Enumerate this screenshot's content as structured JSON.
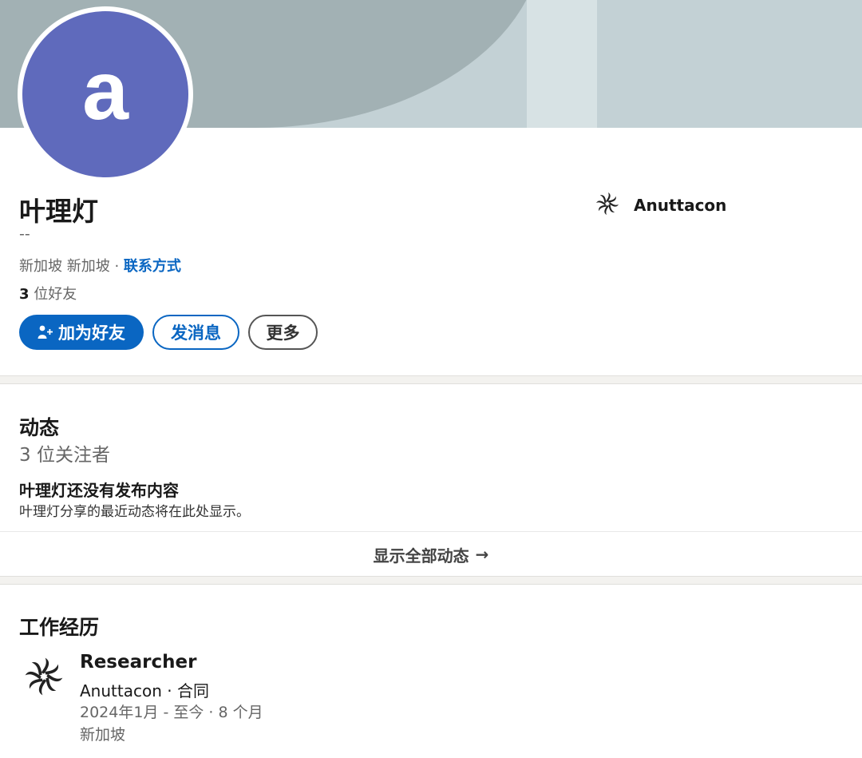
{
  "profile": {
    "avatar_letter": "a",
    "name": "叶理灯",
    "headline": "--",
    "location": "新加坡 新加坡 · ",
    "contact_label": "联系方式",
    "connections_count": "3",
    "connections_label": " 位好友"
  },
  "actions": {
    "connect_label": "加为好友",
    "message_label": "发消息",
    "more_label": "更多"
  },
  "current_company": {
    "name": "Anuttacon",
    "logo_icon": "anuttacon-logo-icon"
  },
  "activity": {
    "title": "动态",
    "followers": "3 位关注者",
    "empty_title": "叶理灯还没有发布内容",
    "empty_subtitle": "叶理灯分享的最近动态将在此处显示。",
    "show_all_label": "显示全部动态",
    "show_all_arrow": "→"
  },
  "experience": {
    "title": "工作经历",
    "items": [
      {
        "role": "Researcher",
        "company": "Anuttacon · 合同",
        "dates": "2024年1月 - 至今 · 8 个月",
        "location": "新加坡"
      }
    ]
  },
  "colors": {
    "brand_blue": "#0a66c2",
    "avatar_bg": "#5f6abc",
    "banner_dark": "#a2b1b4",
    "banner_light": "#c3d1d5"
  }
}
